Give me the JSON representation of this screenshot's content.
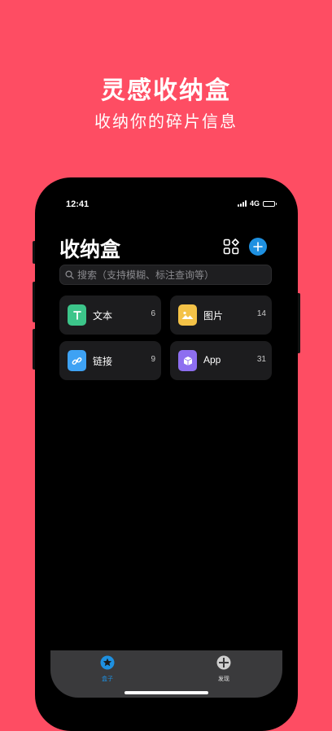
{
  "promo": {
    "title": "灵感收纳盒",
    "subtitle": "收纳你的碎片信息"
  },
  "status_bar": {
    "time": "12:41",
    "network": "4G"
  },
  "header": {
    "title": "收纳盒"
  },
  "search": {
    "placeholder": "搜索（支持模糊、标注查询等）"
  },
  "categories": [
    {
      "name": "文本",
      "count": "6",
      "icon": "text-icon",
      "color": "#3cc58a"
    },
    {
      "name": "图片",
      "count": "14",
      "icon": "image-icon",
      "color": "#f4c247"
    },
    {
      "name": "链接",
      "count": "9",
      "icon": "link-icon",
      "color": "#3ea2f4"
    },
    {
      "name": "App",
      "count": "31",
      "icon": "app-cube-icon",
      "color": "#8d6ef0"
    }
  ],
  "tabbar": {
    "tabs": [
      {
        "label": "盒子",
        "icon": "star-circle-icon",
        "active": true
      },
      {
        "label": "发现",
        "icon": "compass-icon",
        "active": false
      }
    ]
  },
  "colors": {
    "background": "#fe4d63",
    "accent": "#1e90e0",
    "active_tab": "#1e90e0"
  }
}
